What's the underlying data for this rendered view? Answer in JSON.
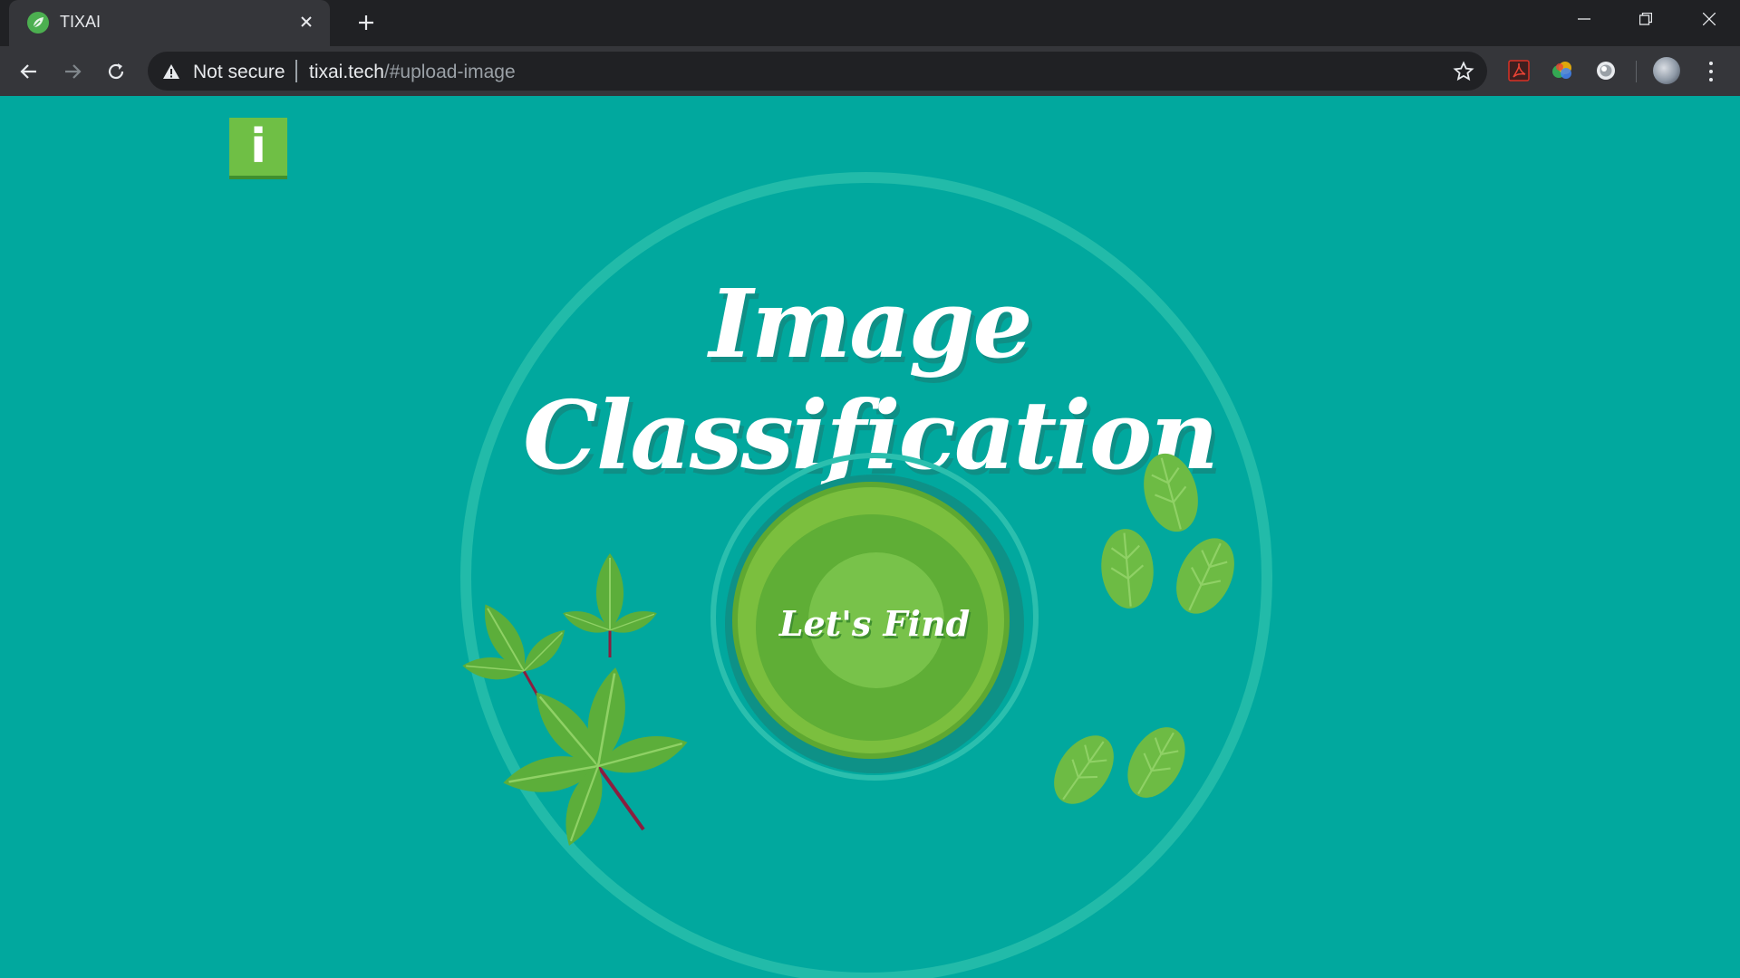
{
  "browser": {
    "tab": {
      "title": "TIXAI"
    },
    "omnibox": {
      "security_label": "Not secure",
      "url_host": "tixai.tech",
      "url_path": "/#upload-image"
    }
  },
  "page": {
    "info_button_label": "i",
    "title": "Image Classification",
    "find_button_label": "Let's Find"
  },
  "colors": {
    "background": "#01a89e",
    "ring": "#22bba9",
    "button_green": "#7bbf3e",
    "info_green": "#6fbf45"
  }
}
